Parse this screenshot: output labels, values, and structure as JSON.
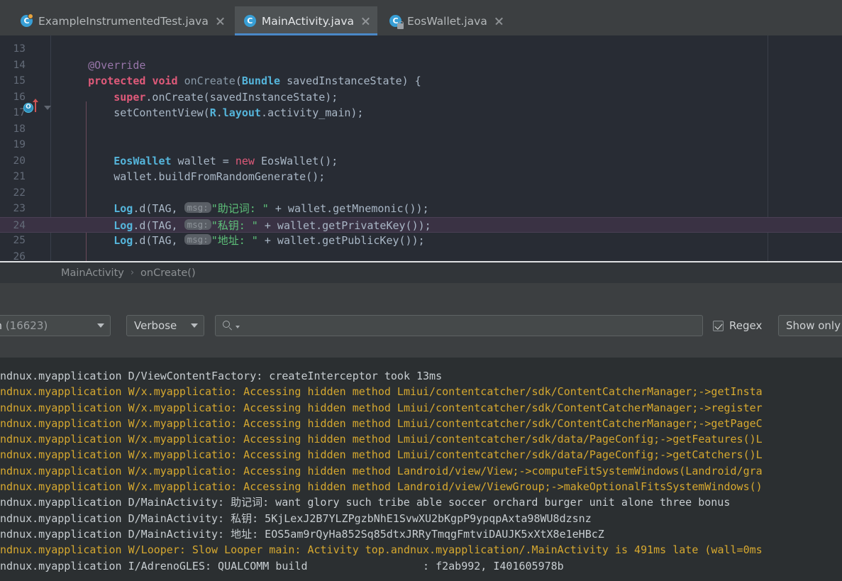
{
  "tabs": [
    {
      "label": "ExampleInstrumentedTest.java",
      "icon": "java-class-icon",
      "active": false,
      "modified": true
    },
    {
      "label": "MainActivity.java",
      "icon": "java-class-icon",
      "active": true,
      "modified": false
    },
    {
      "label": "EosWallet.java",
      "icon": "java-class-private-icon",
      "active": false,
      "modified": false
    }
  ],
  "editor": {
    "first_line_number": 13,
    "highlight_line": 24,
    "lines": [
      {
        "n": 13,
        "segments": []
      },
      {
        "n": 14,
        "segments": [
          {
            "t": "    ",
            "c": "plain"
          },
          {
            "t": "@Override",
            "c": "annp"
          }
        ]
      },
      {
        "n": 15,
        "segments": [
          {
            "t": "    ",
            "c": "plain"
          },
          {
            "t": "protected",
            "c": "kwb"
          },
          {
            "t": " ",
            "c": "plain"
          },
          {
            "t": "void",
            "c": "kwb"
          },
          {
            "t": " ",
            "c": "plain"
          },
          {
            "t": "onCreate",
            "c": "mth"
          },
          {
            "t": "(",
            "c": "plain"
          },
          {
            "t": "Bundle",
            "c": "typb"
          },
          {
            "t": " savedInstanceState) {",
            "c": "plain"
          }
        ]
      },
      {
        "n": 16,
        "segments": [
          {
            "t": "        ",
            "c": "plain"
          },
          {
            "t": "super",
            "c": "kwb"
          },
          {
            "t": ".onCreate(savedInstanceState);",
            "c": "plain"
          }
        ]
      },
      {
        "n": 17,
        "segments": [
          {
            "t": "        setContentView(",
            "c": "plain"
          },
          {
            "t": "R",
            "c": "typb"
          },
          {
            "t": ".",
            "c": "plain"
          },
          {
            "t": "layout",
            "c": "typb"
          },
          {
            "t": ".activity_main);",
            "c": "plain"
          }
        ]
      },
      {
        "n": 18,
        "segments": []
      },
      {
        "n": 19,
        "segments": []
      },
      {
        "n": 20,
        "segments": [
          {
            "t": "        ",
            "c": "plain"
          },
          {
            "t": "EosWallet",
            "c": "typb"
          },
          {
            "t": " wallet = ",
            "c": "plain"
          },
          {
            "t": "new",
            "c": "kwp"
          },
          {
            "t": " EosWallet();",
            "c": "plain"
          }
        ]
      },
      {
        "n": 21,
        "segments": [
          {
            "t": "        wallet.buildFromRandomGenerate();",
            "c": "plain"
          }
        ]
      },
      {
        "n": 22,
        "segments": []
      },
      {
        "n": 23,
        "hint": "msg:",
        "segments": [
          {
            "t": "        ",
            "c": "plain"
          },
          {
            "t": "Log",
            "c": "typb"
          },
          {
            "t": ".d(TAG, ",
            "c": "plain"
          },
          {
            "t": "HINT",
            "c": "hint"
          },
          {
            "t": "\"助记词: \"",
            "c": "str"
          },
          {
            "t": " + wallet.getMnemonic());",
            "c": "plain"
          }
        ]
      },
      {
        "n": 24,
        "hint": "msg:",
        "segments": [
          {
            "t": "        ",
            "c": "plain"
          },
          {
            "t": "Log",
            "c": "typb"
          },
          {
            "t": ".d(TAG, ",
            "c": "plain"
          },
          {
            "t": "HINT",
            "c": "hint"
          },
          {
            "t": "\"私钥: \"",
            "c": "str"
          },
          {
            "t": " + wallet.getPrivateKey());",
            "c": "plain"
          }
        ]
      },
      {
        "n": 25,
        "hint": "msg:",
        "segments": [
          {
            "t": "        ",
            "c": "plain"
          },
          {
            "t": "Log",
            "c": "typb"
          },
          {
            "t": ".d(TAG, ",
            "c": "plain"
          },
          {
            "t": "HINT",
            "c": "hint"
          },
          {
            "t": "\"地址: \"",
            "c": "str"
          },
          {
            "t": " + wallet.getPublicKey());",
            "c": "plain"
          }
        ]
      },
      {
        "n": 26,
        "segments": []
      }
    ],
    "hint_label": "msg:"
  },
  "breadcrumb": {
    "items": [
      "MainActivity",
      "onCreate()"
    ],
    "separator": "›"
  },
  "logcat": {
    "process_label": "plication",
    "process_pid": "(16623)",
    "level": "Verbose",
    "search_value": "",
    "search_placeholder": "",
    "regex_label": "Regex",
    "regex_checked": true,
    "show_only_label": "Show only ",
    "lines": [
      {
        "level": "debug",
        "text": "ndnux.myapplication D/ViewContentFactory: createInterceptor took 13ms"
      },
      {
        "level": "warn",
        "text": "ndnux.myapplication W/x.myapplicatio: Accessing hidden method Lmiui/contentcatcher/sdk/ContentCatcherManager;->getInsta"
      },
      {
        "level": "warn",
        "text": "ndnux.myapplication W/x.myapplicatio: Accessing hidden method Lmiui/contentcatcher/sdk/ContentCatcherManager;->register"
      },
      {
        "level": "warn",
        "text": "ndnux.myapplication W/x.myapplicatio: Accessing hidden method Lmiui/contentcatcher/sdk/ContentCatcherManager;->getPageC"
      },
      {
        "level": "warn",
        "text": "ndnux.myapplication W/x.myapplicatio: Accessing hidden method Lmiui/contentcatcher/sdk/data/PageConfig;->getFeatures()L"
      },
      {
        "level": "warn",
        "text": "ndnux.myapplication W/x.myapplicatio: Accessing hidden method Lmiui/contentcatcher/sdk/data/PageConfig;->getCatchers()L"
      },
      {
        "level": "warn",
        "text": "ndnux.myapplication W/x.myapplicatio: Accessing hidden method Landroid/view/View;->computeFitSystemWindows(Landroid/gra"
      },
      {
        "level": "warn",
        "text": "ndnux.myapplication W/x.myapplicatio: Accessing hidden method Landroid/view/ViewGroup;->makeOptionalFitsSystemWindows()"
      },
      {
        "level": "debug",
        "text": "ndnux.myapplication D/MainActivity: 助记词: want glory such tribe able soccer orchard burger unit alone three bonus"
      },
      {
        "level": "debug",
        "text": "ndnux.myapplication D/MainActivity: 私钥: 5KjLexJ2B7YLZPgzbNhE1SvwXU2bKgpP9ypqpAxta98WU8dzsnz"
      },
      {
        "level": "debug",
        "text": "ndnux.myapplication D/MainActivity: 地址: EOS5am9rQyHa852Sq85dtxJRRyTmqgFmtviDAUJK5xXtX8e1eHBcZ"
      },
      {
        "level": "warn",
        "text": "ndnux.myapplication W/Looper: Slow Looper main: Activity top.andnux.myapplication/.MainActivity is 491ms late (wall=0ms"
      },
      {
        "level": "info",
        "text": "ndnux.myapplication I/AdrenoGLES: QUALCOMM build                  : f2ab992, I401605978b"
      }
    ]
  },
  "colors": {
    "tab_active_bg": "#4e5254",
    "tab_underline": "#4a88c7",
    "editor_bg": "#282c34",
    "panel_bg": "#3c3f41",
    "log_bg": "#2b2f31",
    "warn_text": "#d6a82f",
    "debug_text": "#c7cdd1",
    "string_green": "#5ec27a",
    "keyword_pink": "#e05a7a",
    "type_blue": "#55b5db"
  }
}
